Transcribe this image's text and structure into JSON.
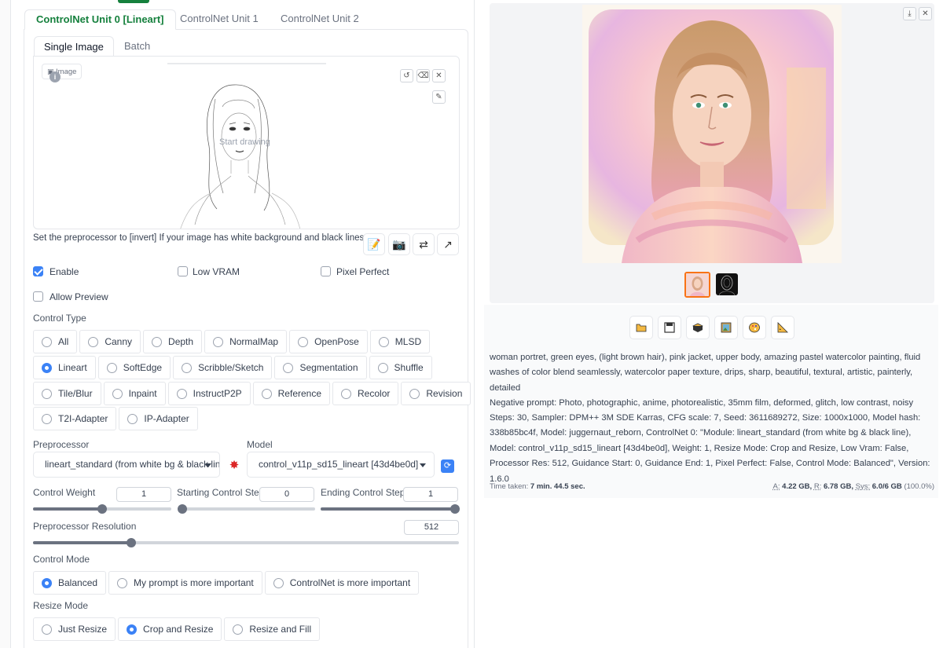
{
  "units": {
    "tabs": [
      {
        "label": "ControlNet Unit 0 [Lineart]"
      },
      {
        "label": "ControlNet Unit 1"
      },
      {
        "label": "ControlNet Unit 2"
      }
    ],
    "subtabs": [
      {
        "label": "Single Image"
      },
      {
        "label": "Batch"
      }
    ]
  },
  "canvas": {
    "image_label": "Image",
    "start_drawing": "Start drawing"
  },
  "hint": "Set the preprocessor to [invert] If your image has white background and black lines.",
  "checkboxes": {
    "enable": {
      "label": "Enable",
      "checked": true
    },
    "low_vram": {
      "label": "Low VRAM",
      "checked": false
    },
    "pixel_perfect": {
      "label": "Pixel Perfect",
      "checked": false
    },
    "allow_preview": {
      "label": "Allow Preview",
      "checked": false
    }
  },
  "control_type": {
    "label": "Control Type",
    "rows": [
      [
        "All",
        "Canny",
        "Depth",
        "NormalMap",
        "OpenPose",
        "MLSD"
      ],
      [
        "Lineart",
        "SoftEdge",
        "Scribble/Sketch",
        "Segmentation",
        "Shuffle"
      ],
      [
        "Tile/Blur",
        "Inpaint",
        "InstructP2P",
        "Reference",
        "Recolor",
        "Revision"
      ],
      [
        "T2I-Adapter",
        "IP-Adapter"
      ]
    ],
    "selected": "Lineart"
  },
  "preprocessor": {
    "label": "Preprocessor",
    "value": "lineart_standard (from white bg & black lines)"
  },
  "model": {
    "label": "Model",
    "value": "control_v11p_sd15_lineart [43d4be0d]"
  },
  "sliders": {
    "control_weight": {
      "label": "Control Weight",
      "value": "1",
      "fraction": 0.5
    },
    "starting_step": {
      "label": "Starting Control Step",
      "value": "0",
      "fraction": 0.0
    },
    "ending_step": {
      "label": "Ending Control Step",
      "value": "1",
      "fraction": 1.0
    },
    "preprocessor_resolution": {
      "label": "Preprocessor Resolution",
      "value": "512",
      "fraction": 0.23
    }
  },
  "control_mode": {
    "label": "Control Mode",
    "options": [
      "Balanced",
      "My prompt is more important",
      "ControlNet is more important"
    ],
    "selected": "Balanced"
  },
  "resize_mode": {
    "label": "Resize Mode",
    "options": [
      "Just Resize",
      "Crop and Resize",
      "Resize and Fill"
    ],
    "selected": "Crop and Resize"
  },
  "output": {
    "prompt": "woman portret, green eyes, (light brown hair), pink jacket, upper body, amazing pastel watercolor painting, fluid washes of color blend seamlessly, watercolor paper texture, drips, sharp, beautiful, textural, artistic, painterly, detailed",
    "negative": "Negative prompt: Photo, photographic, anime, photorealistic, 35mm film, deformed, glitch, low contrast, noisy",
    "params": "Steps: 30, Sampler: DPM++ 3M SDE Karras, CFG scale: 7, Seed: 3611689272, Size: 1000x1000, Model hash: 338b85bc4f, Model: juggernaut_reborn, ControlNet 0: \"Module: lineart_standard (from white bg & black line), Model: control_v11p_sd15_lineart [43d4be0d], Weight: 1, Resize Mode: Crop and Resize, Low Vram: False, Processor Res: 512, Guidance Start: 0, Guidance End: 1, Pixel Perfect: False, Control Mode: Balanced\", Version: 1.6.0",
    "time_label": "Time taken:",
    "time_value": "7 min. 44.5 sec.",
    "vram_a_label": "A:",
    "vram_a": "4.22 GB,",
    "vram_r_label": "R:",
    "vram_r": "6.78 GB,",
    "vram_sys_label": "Sys:",
    "vram_sys": "6.0/6 GB",
    "vram_pct": "(100.0%)"
  },
  "colors": {
    "accent_green": "#15803d",
    "accent_blue": "#3b82f6",
    "thumb_selected": "#f97316"
  }
}
